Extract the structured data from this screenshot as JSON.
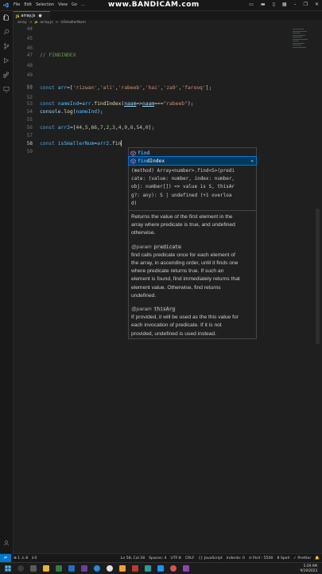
{
  "watermark": "www.BANDICAM.com",
  "menu": [
    "File",
    "Edit",
    "Selection",
    "View",
    "Go",
    "…"
  ],
  "tab": {
    "badge": "JS",
    "label": "array.js",
    "dot": "●"
  },
  "breadcrumb": {
    "folder": "array",
    "sep": ">",
    "badge": "JS",
    "file": "array.js",
    "symbol": "isSmallerNum"
  },
  "editor": {
    "line_numbers": [
      "44",
      "45",
      "46",
      "47",
      "48",
      "49",
      "50",
      "51",
      "52",
      "53",
      "54",
      "55",
      "56",
      "57",
      "58",
      "59"
    ],
    "current_line": "58",
    "comment": "// FINDINDEX",
    "arr_kw": "const",
    "arr_name": "arr",
    "arr_strings": [
      "'rizwan'",
      "'ali'",
      "'rabeeb'",
      "'hai'",
      "'za9'",
      "'farooq'"
    ],
    "nameInd_line": {
      "kw": "const",
      "name": "nameInd",
      "obj": "arr",
      "method": "findIndex",
      "param": "naam",
      "param2": "naam",
      "op": "===",
      "str": "\"rabeeb\""
    },
    "log_line": {
      "obj": "console",
      "method": "log",
      "arg": "nameInd"
    },
    "arr2_line": {
      "kw": "const",
      "name": "arr2",
      "values": [
        "44",
        "5",
        "66",
        "7",
        "2",
        "3",
        "4",
        "9",
        "6",
        "54",
        "0"
      ]
    },
    "current_code": {
      "kw": "const",
      "name": "isSmallerNum",
      "obj": "arr2",
      "typed": "fin"
    }
  },
  "suggestions": [
    {
      "bold": "fin",
      "rest": "d",
      "selected": false
    },
    {
      "bold": "fin",
      "rest": "dIndex",
      "selected": true
    }
  ],
  "suggest_close": "✕",
  "docs": {
    "signature": [
      "(method) Array<number>.find<S>(predi",
      "cate: (value: number, index: number,",
      "obj: number[]) => value is S, thisAr",
      "g?: any): S | undefined (+1 overloa",
      "d)"
    ],
    "description": [
      "Returns the value of the first element in the",
      "array where predicate is true, and undefined",
      "otherwise."
    ],
    "param1_tag": "@param",
    "param1_name": "predicate",
    "param1_text": [
      "find calls predicate once for each element of",
      "the array, in ascending order, until it finds one",
      "where predicate returns true. If such an",
      "element is found, find immediately returns that",
      "element value. Otherwise, find returns",
      "undefined."
    ],
    "param2_tag": "@param",
    "param2_name": "thisArg",
    "param2_text": [
      "If provided, it will be used as the this value for",
      "each invocation of predicate. If it is not",
      "provided, undefined is used instead."
    ]
  },
  "statusbar": {
    "left": [
      "⊗ 1 ⚠ 8",
      "ℹ 0"
    ],
    "right": [
      "Ln 58, Col 28",
      "Spaces: 4",
      "UTF-8",
      "CRLF",
      "{} JavaScript",
      "Indents: 0",
      "⊙ Port : 5500",
      "8 Spell",
      "✓ Prettier"
    ]
  },
  "taskbar": {
    "time": "5:29 AM",
    "date": "9/19/2023"
  },
  "colors": {
    "accent": "#0078d4",
    "editor_bg": "#1f1f1f",
    "keyword": "#569cd6",
    "string": "#ce9178",
    "number": "#b5cea8",
    "function": "#dcdcaa",
    "comment": "#6a9955"
  },
  "icons": [
    "vscode-logo-icon",
    "explorer-icon",
    "search-icon",
    "source-control-icon",
    "run-debug-icon",
    "extensions-icon",
    "remote-icon",
    "testing-icon",
    "account-icon",
    "settings-gear-icon",
    "method-cube-icon",
    "windows-start-icon"
  ]
}
